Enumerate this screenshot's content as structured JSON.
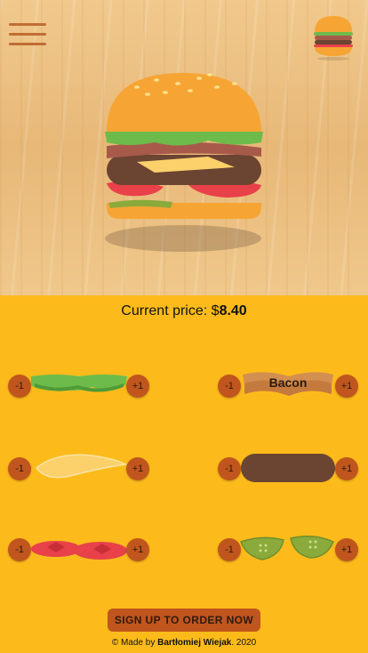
{
  "header": {
    "menu_icon": "hamburger-menu-icon",
    "mini_burger_icon": "burger-preview-icon"
  },
  "price": {
    "label": "Current price:",
    "currency": "$",
    "value": "8.40"
  },
  "ingredients": [
    {
      "name": "lettuce",
      "minus": "-1",
      "plus": "+1",
      "label": ""
    },
    {
      "name": "bacon",
      "minus": "-1",
      "plus": "+1",
      "label": "Bacon"
    },
    {
      "name": "cheese",
      "minus": "-1",
      "plus": "+1",
      "label": ""
    },
    {
      "name": "meat",
      "minus": "-1",
      "plus": "+1",
      "label": ""
    },
    {
      "name": "tomato",
      "minus": "-1",
      "plus": "+1",
      "label": ""
    },
    {
      "name": "pickle",
      "minus": "-1",
      "plus": "+1",
      "label": ""
    }
  ],
  "cta": {
    "label": "SIGN UP TO ORDER NOW"
  },
  "footer": {
    "prefix": "© Made by ",
    "author": "Bartłomiej Wiejak",
    "suffix": ". 2020"
  },
  "colors": {
    "panel": "#fdbb1b",
    "button": "#c0561d",
    "bun": "#f6a534",
    "lettuce": "#6dbb4b",
    "meat": "#6b4432",
    "cheese": "#fcd06a",
    "tomato": "#e8414a",
    "pickle": "#8aaa3c"
  }
}
